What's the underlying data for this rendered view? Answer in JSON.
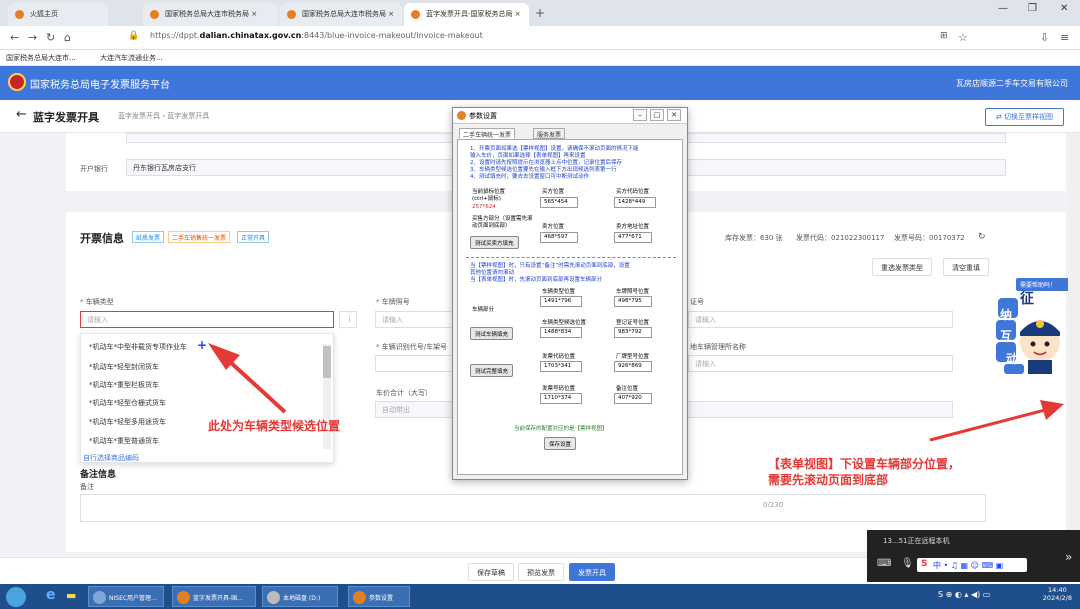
{
  "browser": {
    "tabs": [
      {
        "label": "火狐主页",
        "active": false
      },
      {
        "label": "国家税务总局大连市税务局 ×",
        "active": false
      },
      {
        "label": "国家税务总局大连市税务局 ×",
        "active": false
      },
      {
        "label": "蓝字发票开具-国家税务总局 ×",
        "active": true
      }
    ],
    "url_prefix": "https://dppt.",
    "url_domain": "dalian.chinatax.gov.cn",
    "url_suffix": ":8443/blue-invoice-makeout/invoice-makeout",
    "bookmarks": [
      "国家税务总局大连市...",
      "大连汽车流通业务..."
    ]
  },
  "app": {
    "title": "国家税务总局电子发票服务平台",
    "user": "瓦房店顺源二手车交易有限公司",
    "page_title": "蓝字发票开具",
    "breadcrumb": "蓝字发票开具 › 蓝字发票开具",
    "switch_view": "切换至票样视图"
  },
  "bank": {
    "label": "开户银行",
    "value": "丹东银行瓦房店支行"
  },
  "invoice": {
    "section_title": "开票信息",
    "tags": [
      "纸质发票",
      "二手车销售统一发票",
      "正常开具"
    ],
    "stock": "库存发票：630 张",
    "code": "发票代码：021022300117",
    "number": "发票号码：00170372",
    "reselect": "重选发票类型",
    "clear": "清空重填"
  },
  "fields": {
    "vehicle_type": "车辆类型",
    "vehicle_type_ph": "请输入",
    "plate": "车牌照号",
    "plate_ph": "请输入",
    "cert_suffix": "证号",
    "cert_ph": "请输入",
    "vin": "车辆识别代号/车架号",
    "mgmt": "地车辆管理所名称",
    "mgmt_ph": "请输入",
    "total": "车价合计（大写）",
    "total_ph": "自动带出",
    "remark_title": "备注信息",
    "remark_label": "备注",
    "counter": "0/230"
  },
  "dropdown": {
    "items": [
      "*机动车*中型非载货专项作业车",
      "*机动车*轻型封闭货车",
      "*机动车*重型栏板货车",
      "*机动车*轻型仓栅式货车",
      "*机动车*轻型多用途货车",
      "*机动车*重型普通货车"
    ],
    "footer": "自行选择商品编码"
  },
  "dialog": {
    "title": "参数设置",
    "tabs": [
      "二手车辆统一发票",
      "服务发票"
    ],
    "instructions": [
      "1、开票页面如果选【票样视图】设置，请确保不滚动页面的情况下能",
      "输入车价，页面如果选择【表单视图】再来设置",
      "2、设置时请先按照提示在浏览器上点中位置，记录位置后保存",
      "3、车辆类型候选位置要先在输入框下方出现候选列表第一行",
      "4、测试填充时，要去去设置窗口可中断测试动作"
    ],
    "current_label": "当前鼠标位置",
    "current_hint": "(ctrl+鼠标)",
    "current_value": "257*624",
    "buyer_pos_label": "买方位置",
    "buyer_pos": "565*454",
    "buyer_code_label": "买方代码位置",
    "buyer_code": "1428*449",
    "seller_hint": "买售方部分（设置需先滚动页面到底部）",
    "seller_pos_label": "卖方位置",
    "seller_pos": "468*597",
    "seller_addr_label": "卖方地址位置",
    "seller_addr": "477*671",
    "test_buyer_btn": "测试买卖方填充",
    "note1": "当【票样视图】时，只有设置“备注”时需先滚动页面到底部，设置",
    "note2": "其他位置请勿滚动",
    "note3": "当【表单视图】时，先滚动页面到底部再设置车辆部分",
    "vehicle_label": "车辆部分",
    "vtype_label": "车辆类型位置",
    "vtype": "1491*796",
    "plate_label": "车牌照号位置",
    "plate": "498*795",
    "vtype_cand_label": "车辆类型候选位置",
    "vtype_cand": "1488*834",
    "reg_label": "登记证号位置",
    "reg": "983*792",
    "test_vehicle_btn": "测试车辆填充",
    "engine_label": "发票代码位置",
    "engine": "1703*341",
    "factory_label": "厂牌型号位置",
    "factory": "926*869",
    "test_full_btn": "测试完整填充",
    "invno_label": "发票号码位置",
    "invno": "1710*374",
    "remark_label": "备注位置",
    "remark": "407*920",
    "saved_note": "当前保存的配置对应的是【票样视图】",
    "save_btn": "保存设置"
  },
  "annotations": {
    "left": "此处为车辆类型候选位置",
    "right1": "【表单视图】下设置车辆部分位置，",
    "right2": "需要先滚动页面到底部"
  },
  "actions": {
    "draft": "保存草稿",
    "preview": "预览发票",
    "issue": "发票开具"
  },
  "help": "需要帮助吗！",
  "mascot": [
    "征",
    "纳",
    "互",
    "动"
  ],
  "remote_text": "13...51正在远程本机",
  "taskbar": {
    "items": [
      "NISEC用户管理...",
      "蓝字发票开具-国...",
      "本地磁盘 (D:)",
      "参数设置"
    ],
    "time": "14:40",
    "date": "2024/2/8"
  },
  "colors": {
    "brand": "#3f76d9",
    "annotation": "#e53935",
    "taskbar": "#1f4e8c"
  }
}
